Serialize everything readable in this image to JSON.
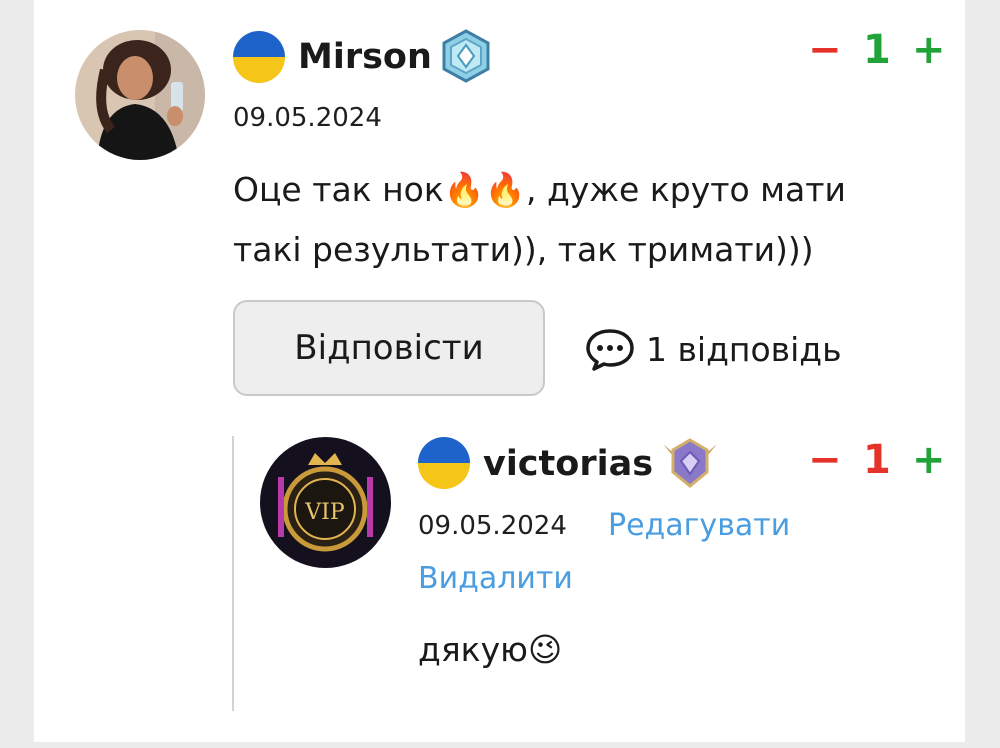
{
  "comment": {
    "author": "Mirson",
    "date": "09.05.2024",
    "text_line1": "Оце так нок🔥🔥,  дуже круто мати",
    "text_line2": "такі результати)), так тримати)))",
    "score": "1",
    "minus_label": "−",
    "plus_label": "+",
    "reply_button_label": "Відповісти",
    "replies_count_label": "1 відповідь"
  },
  "reply": {
    "author": "victorias",
    "date": "09.05.2024",
    "edit_label": "Редагувати",
    "delete_label": "Видалити",
    "text": "дякую😉",
    "score": "1",
    "minus_label": "−",
    "plus_label": "+",
    "avatar_text": "VIP"
  },
  "colors": {
    "minus": "#e5332a",
    "plus": "#21a33a",
    "link": "#4a9de0",
    "flag_blue": "#1e63c9",
    "flag_yellow": "#f5c518"
  },
  "icons": {
    "flag": "ukraine-flag-icon",
    "badge_mirson": "hex-badge-icon",
    "badge_victorias": "winged-diamond-badge-icon",
    "replies": "chat-bubble-icon"
  }
}
